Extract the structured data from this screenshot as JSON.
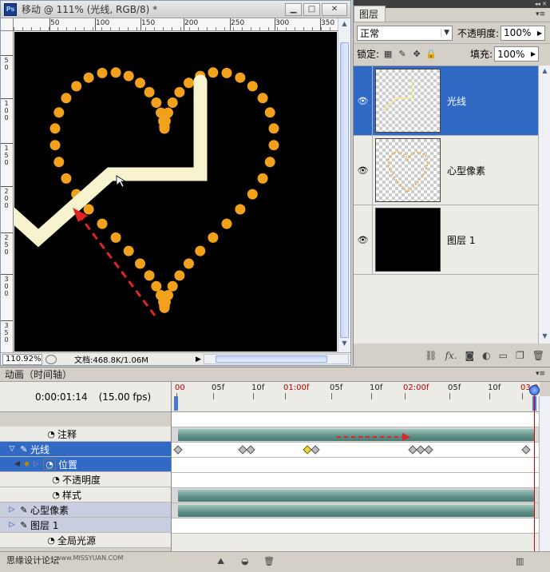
{
  "document": {
    "title": "移动 @ 111% (光线, RGB/8) *",
    "ruler_top": [
      "50",
      "100",
      "150",
      "200",
      "250",
      "300",
      "350"
    ],
    "ruler_left": [
      "5\n0",
      "1\n0\n0",
      "1\n5\n0",
      "2\n0\n0",
      "2\n5\n0",
      "3\n0\n0",
      "3\n5\n0"
    ],
    "zoom": "110.92%",
    "doc_info": "文档:468.8K/1.06M",
    "colors": {
      "dot": "#f2a11c",
      "light_line": "#f8f3cf",
      "arrow": "#e02424"
    }
  },
  "layers_panel": {
    "tab": "图层",
    "blend_mode": "正常",
    "opacity_label": "不透明度:",
    "opacity_value": "100%",
    "lock_label": "锁定:",
    "fill_label": "填充:",
    "fill_value": "100%",
    "layers": [
      {
        "name": "光线",
        "active": true,
        "thumb": "line"
      },
      {
        "name": "心型像素",
        "active": false,
        "thumb": "heart"
      },
      {
        "name": "图层 1",
        "active": false,
        "thumb": "black"
      }
    ],
    "footer_icons": [
      "link-icon",
      "fx-icon",
      "mask-icon",
      "adjustment-icon",
      "group-icon",
      "new-layer-icon",
      "trash-icon"
    ]
  },
  "animation": {
    "tab": "动画（时间轴）",
    "timecode": "0:00:01:14",
    "fps": "(15.00 fps)",
    "ruler": [
      {
        "label": "00",
        "red": true
      },
      {
        "label": "05f",
        "red": false
      },
      {
        "label": "10f",
        "red": false
      },
      {
        "label": "01:00f",
        "red": true
      },
      {
        "label": "05f",
        "red": false
      },
      {
        "label": "10f",
        "red": false
      },
      {
        "label": "02:00f",
        "red": true
      },
      {
        "label": "05f",
        "red": false
      },
      {
        "label": "10f",
        "red": false
      },
      {
        "label": "03:0",
        "red": true
      }
    ],
    "rows": [
      {
        "label": "注释",
        "type": "sub"
      },
      {
        "label": "光线",
        "type": "layer-open"
      },
      {
        "label": "位置",
        "type": "property"
      },
      {
        "label": "不透明度",
        "type": "sub2"
      },
      {
        "label": "样式",
        "type": "sub2"
      },
      {
        "label": "心型像素",
        "type": "layer"
      },
      {
        "label": "图层 1",
        "type": "layer"
      },
      {
        "label": "全局光源",
        "type": "sub"
      }
    ],
    "keyframes": [
      {
        "frame": 0,
        "yellow": false
      },
      {
        "frame": 8,
        "yellow": false
      },
      {
        "frame": 9,
        "yellow": false
      },
      {
        "frame": 16,
        "yellow": true
      },
      {
        "frame": 17,
        "yellow": false
      },
      {
        "frame": 29,
        "yellow": false
      },
      {
        "frame": 30,
        "yellow": false
      },
      {
        "frame": 31,
        "yellow": false
      },
      {
        "frame": 43,
        "yellow": false
      }
    ],
    "current_frame": 44,
    "total_frames": 45,
    "watermark": "思缘设计论坛",
    "watermark_url": "www.MISSYUAN.COM"
  }
}
